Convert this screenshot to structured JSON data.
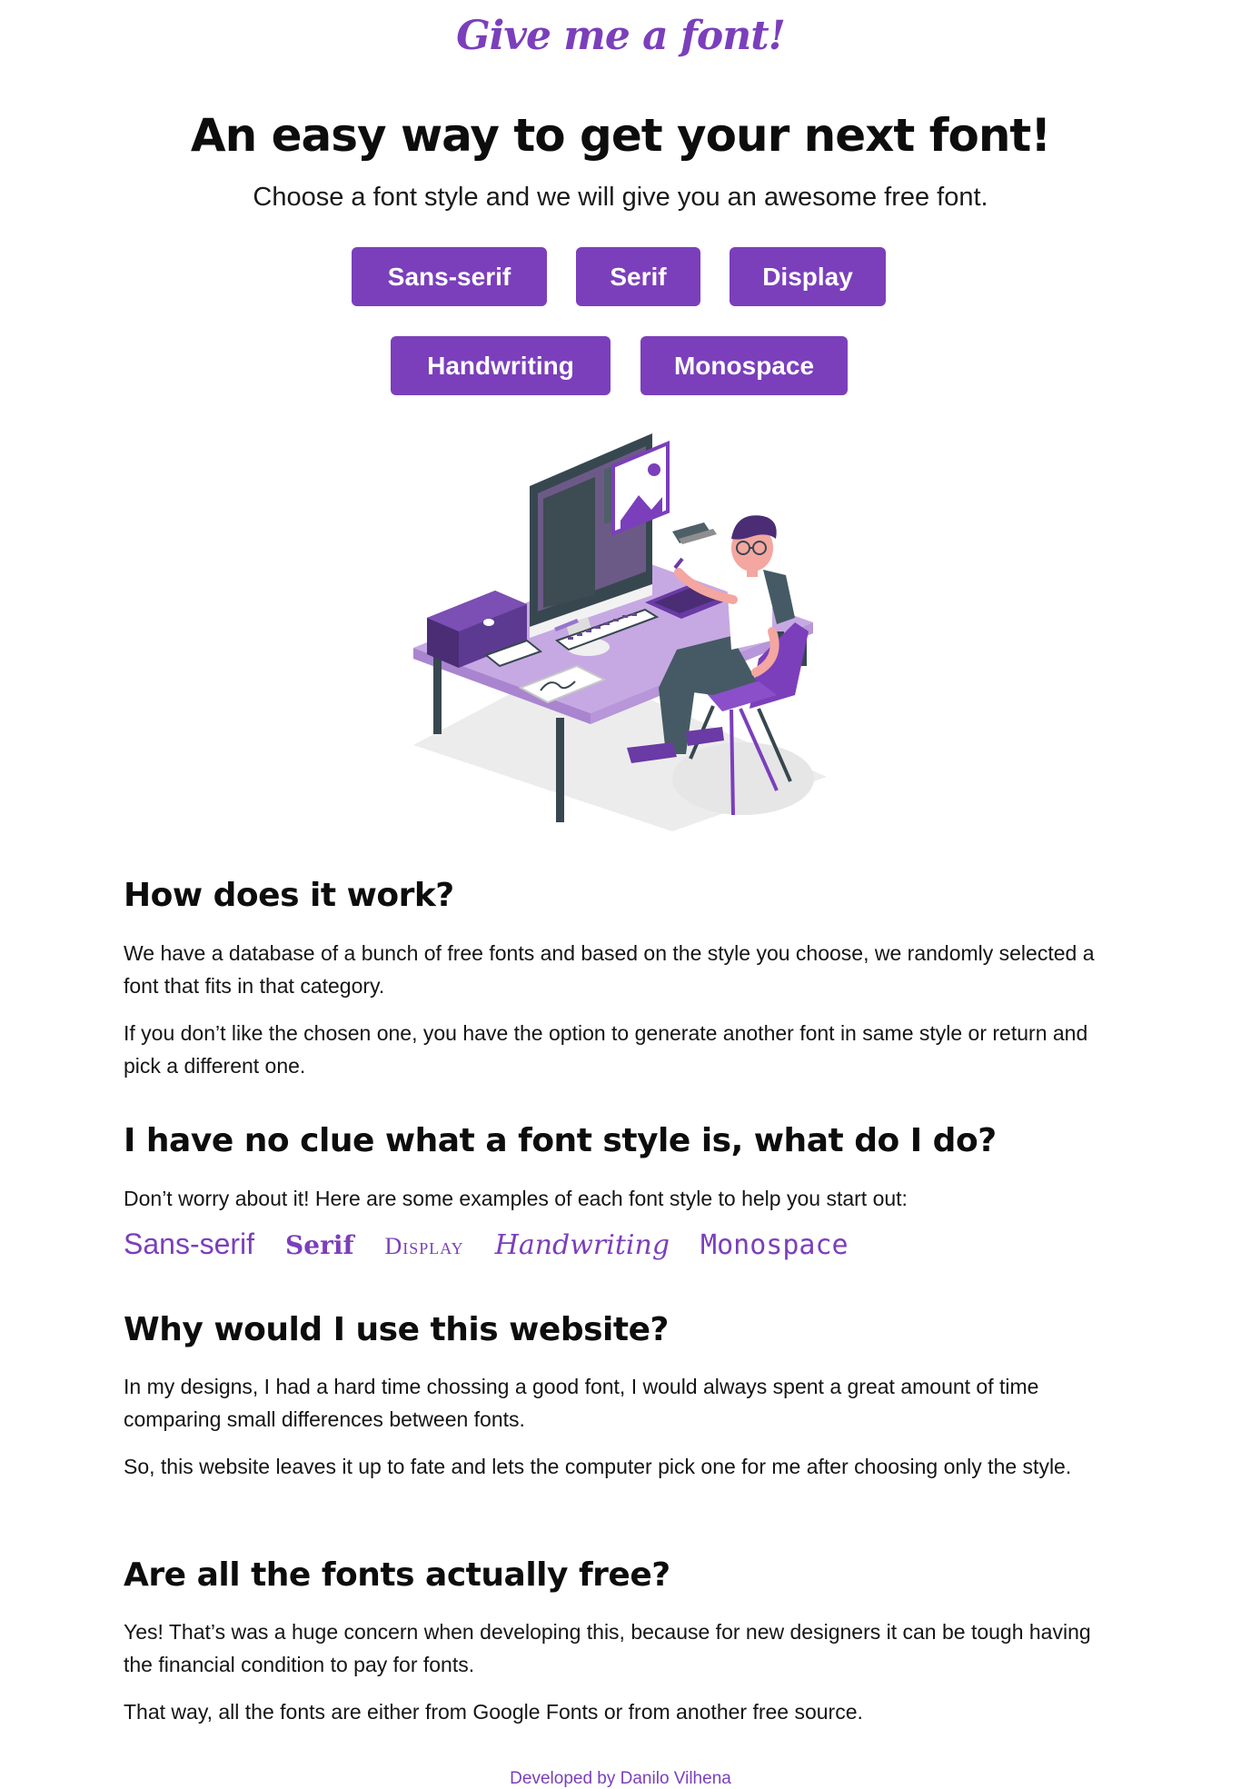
{
  "header": {
    "logo": "Give me a font!"
  },
  "hero": {
    "title": "An easy way to get your next font!",
    "subtitle": "Choose a font style and we will give you an awesome free font.",
    "buttons": [
      "Sans-serif",
      "Serif",
      "Display",
      "Handwriting",
      "Monospace"
    ]
  },
  "faq": [
    {
      "heading": "How does it work?",
      "paragraphs": [
        "We have a database of a bunch of free fonts and based on the style you choose, we randomly selected a font that fits in that category.",
        "If you don’t like the chosen one, you have the option to generate another font in same style or return and pick a different one."
      ]
    },
    {
      "heading": "I have no clue what a font style is, what do I do?",
      "paragraphs": [
        "Don’t worry about it! Here are some examples of each font style to help you start out:"
      ],
      "samples": [
        "Sans-serif",
        "Serif",
        "Display",
        "Handwriting",
        "Monospace"
      ]
    },
    {
      "heading": "Why would I use this website?",
      "paragraphs": [
        "In my designs, I had a hard time chossing a good font, I would always spent a great amount of time comparing small differences between fonts.",
        "So, this website leaves it up to fate and lets the computer pick one for me after choosing only the style."
      ]
    },
    {
      "heading": "Are all the fonts actually free?",
      "paragraphs": [
        "Yes! That’s was a huge concern when developing this, because for new designers it can be tough having the financial condition to pay for fonts.",
        "That way, all the fonts are either from Google Fonts or from another free source."
      ]
    }
  ],
  "footer": {
    "text": "Developed by Danilo Vilhena"
  },
  "colors": {
    "accent": "#7b3fbb",
    "text": "#111111",
    "background": "#ffffff"
  },
  "illustration": {
    "icon": "person-at-desk-illustration"
  }
}
